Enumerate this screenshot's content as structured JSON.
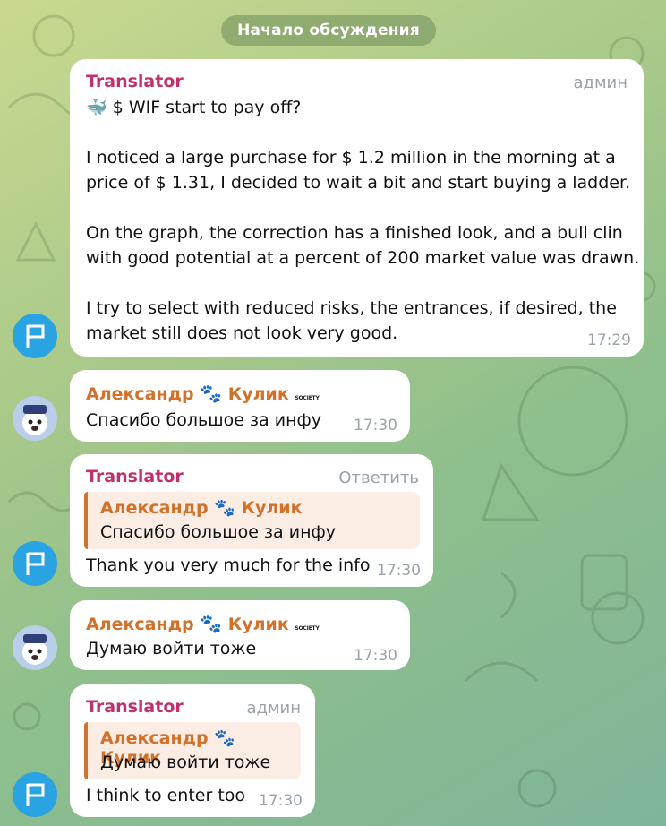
{
  "header": {
    "pill": "Начало обсуждения"
  },
  "messages": [
    {
      "sender": "Translator",
      "tag": "админ",
      "lines": [
        "🐳 $ WIF start to pay off?",
        "",
        "I noticed a large purchase for $ 1.2 million in the morning at a",
        "price of $ 1.31, I decided to wait a bit and start buying a ladder.",
        "",
        "On the graph, the correction has a finished look, and a bull clin",
        "with good potential at a percent of 200 market value was drawn.",
        "",
        "I try to select with reduced risks, the entrances, if desired, the",
        "market still does not look very good."
      ],
      "time": "17:29"
    },
    {
      "sender_first": "Александр",
      "sender_paw": "🐾",
      "sender_last": "Кулик",
      "sender_badge": "SOCIETY",
      "text": "Спасибо большое за инфу",
      "time": "17:30"
    },
    {
      "sender": "Translator",
      "tag": "Ответить",
      "reply_name": "Александр 🐾 Кулик",
      "reply_text": "Спасибо большое за инфу",
      "text": "Thank you very much for the info",
      "time": "17:30"
    },
    {
      "sender_first": "Александр",
      "sender_paw": "🐾",
      "sender_last": "Кулик",
      "sender_badge": "SOCIETY",
      "text": "Думаю войти тоже",
      "time": "17:30"
    },
    {
      "sender": "Translator",
      "tag": "админ",
      "reply_name": "Александр 🐾 Кулик",
      "reply_text": "Думаю войти тоже",
      "text": "I think to enter too",
      "time": "17:30"
    }
  ],
  "colors": {
    "translator": "#c0306d",
    "alexander": "#d2722a",
    "flag_avatar": "#2aa3e2"
  },
  "icons": {
    "translator_avatar": "flag-icon",
    "alexander_avatar": "dog-avatar-icon"
  }
}
